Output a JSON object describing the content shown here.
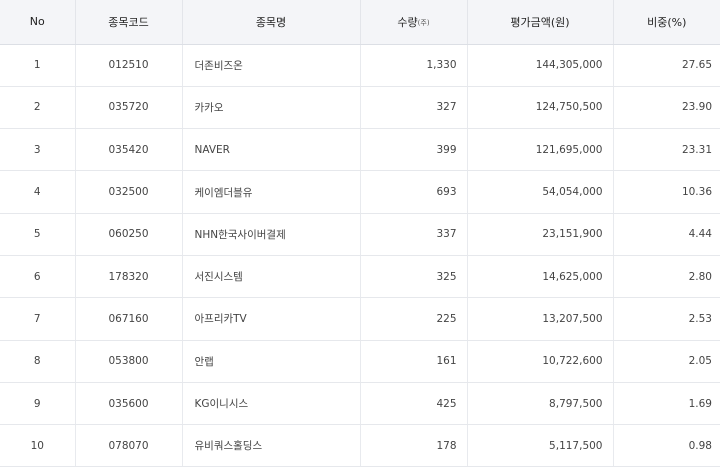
{
  "table": {
    "headers": {
      "no": "No",
      "code": "종목코드",
      "name": "종목명",
      "qty": "수량",
      "qty_unit": "(주)",
      "value": "평가금액(원)",
      "weight": "비중(%)"
    },
    "rows": [
      {
        "no": "1",
        "code": "012510",
        "name": "더존비즈온",
        "qty": "1,330",
        "value": "144,305,000",
        "weight": "27.65"
      },
      {
        "no": "2",
        "code": "035720",
        "name": "카카오",
        "qty": "327",
        "value": "124,750,500",
        "weight": "23.90"
      },
      {
        "no": "3",
        "code": "035420",
        "name": "NAVER",
        "qty": "399",
        "value": "121,695,000",
        "weight": "23.31"
      },
      {
        "no": "4",
        "code": "032500",
        "name": "케이엠더블유",
        "qty": "693",
        "value": "54,054,000",
        "weight": "10.36"
      },
      {
        "no": "5",
        "code": "060250",
        "name": "NHN한국사이버결제",
        "qty": "337",
        "value": "23,151,900",
        "weight": "4.44"
      },
      {
        "no": "6",
        "code": "178320",
        "name": "서진시스템",
        "qty": "325",
        "value": "14,625,000",
        "weight": "2.80"
      },
      {
        "no": "7",
        "code": "067160",
        "name": "아프리카TV",
        "qty": "225",
        "value": "13,207,500",
        "weight": "2.53"
      },
      {
        "no": "8",
        "code": "053800",
        "name": "안랩",
        "qty": "161",
        "value": "10,722,600",
        "weight": "2.05"
      },
      {
        "no": "9",
        "code": "035600",
        "name": "KG이니시스",
        "qty": "425",
        "value": "8,797,500",
        "weight": "1.69"
      },
      {
        "no": "10",
        "code": "078070",
        "name": "유비쿼스홀딩스",
        "qty": "178",
        "value": "5,117,500",
        "weight": "0.98"
      }
    ]
  }
}
